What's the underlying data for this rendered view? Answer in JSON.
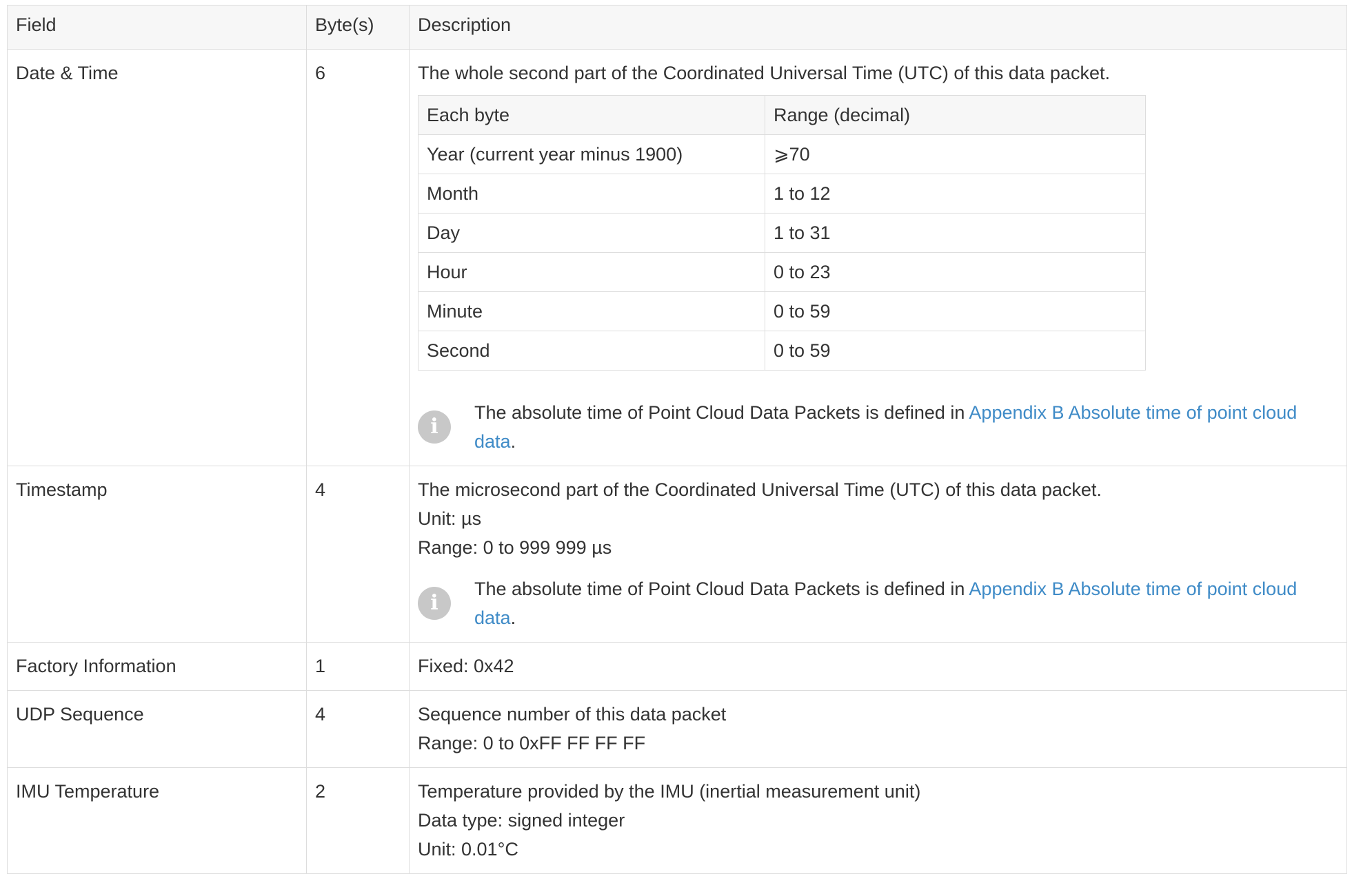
{
  "table": {
    "headers": [
      "Field",
      "Byte(s)",
      "Description"
    ],
    "rows": {
      "date_time": {
        "field": "Date & Time",
        "bytes": "6",
        "description": "The whole second part of the Coordinated Universal Time (UTC) of this data packet.",
        "subtable": {
          "headers": [
            "Each byte",
            "Range (decimal)"
          ],
          "rows": [
            [
              "Year (current year minus 1900)",
              "⩾70"
            ],
            [
              "Month",
              "1 to 12"
            ],
            [
              "Day",
              "1 to 31"
            ],
            [
              "Hour",
              "0 to 23"
            ],
            [
              "Minute",
              "0 to 59"
            ],
            [
              "Second",
              "0 to 59"
            ]
          ]
        },
        "note": {
          "icon": "info-icon",
          "text": "The absolute time of Point Cloud Data Packets is defined in ",
          "link": "Appendix B Absolute time of point cloud data",
          "suffix": "."
        }
      },
      "timestamp": {
        "field": "Timestamp",
        "bytes": "4",
        "lines": [
          "The microsecond part of the Coordinated Universal Time (UTC) of this data packet.",
          "Unit: µs",
          "Range: 0 to 999 999 µs"
        ],
        "note": {
          "icon": "info-icon",
          "text": "The absolute time of Point Cloud Data Packets is defined in ",
          "link": "Appendix B Absolute time of point cloud data",
          "suffix": "."
        }
      },
      "factory": {
        "field": "Factory Information",
        "bytes": "1",
        "lines": [
          "Fixed: 0x42"
        ]
      },
      "udp": {
        "field": "UDP Sequence",
        "bytes": "4",
        "lines": [
          "Sequence number of this data packet",
          "Range: 0 to 0xFF FF FF FF"
        ]
      },
      "imu": {
        "field": "IMU Temperature",
        "bytes": "2",
        "lines": [
          "Temperature provided by the IMU (inertial measurement unit)",
          "Data type: signed integer",
          "Unit: 0.01°C"
        ]
      }
    }
  },
  "colors": {
    "link": "#3f8bc7",
    "border": "#dddddd",
    "header_bg": "#f7f7f7",
    "icon_bg": "#c8c8c8"
  }
}
